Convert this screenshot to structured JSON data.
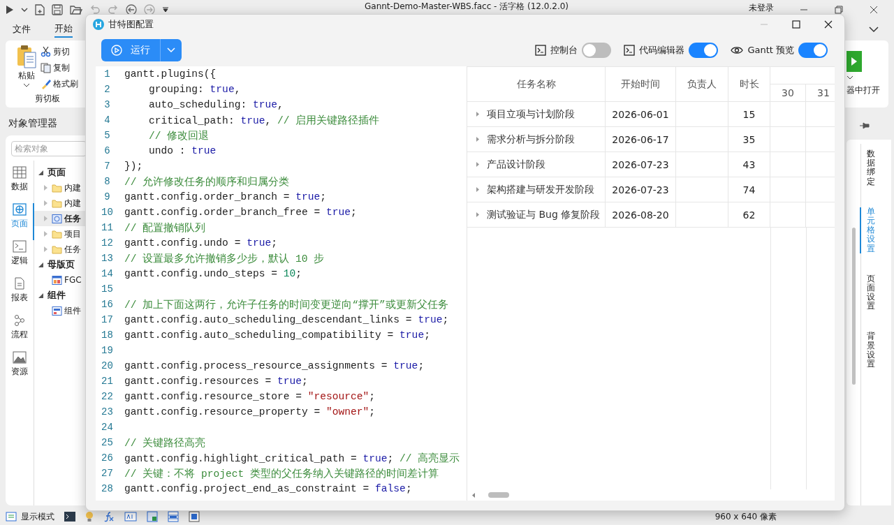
{
  "app": {
    "title": "Gannt-Demo-Master-WBS.facc - 活字格 (12.0.2.0)",
    "user": "未登录"
  },
  "menu": [
    {
      "label": "文件",
      "selected": false
    },
    {
      "label": "开始",
      "selected": true
    }
  ],
  "ribbon": {
    "paste": "粘贴",
    "cut": "剪切",
    "copy": "复制",
    "format_painter": "格式刷",
    "group": "剪切板",
    "open_in_browser": "器中打开"
  },
  "object_manager": {
    "title": "对象管理器",
    "search": {
      "placeholder": "检索对象"
    },
    "nav": [
      {
        "label": "数据",
        "kind": "data",
        "selected": false
      },
      {
        "label": "页面",
        "kind": "page",
        "selected": true
      },
      {
        "label": "逻辑",
        "kind": "logic",
        "selected": false
      },
      {
        "label": "报表",
        "kind": "report",
        "selected": false
      },
      {
        "label": "流程",
        "kind": "flow",
        "selected": false
      },
      {
        "label": "资源",
        "kind": "resource",
        "selected": false
      }
    ],
    "tree": [
      {
        "label": "页面",
        "expanded": true,
        "selected": false,
        "children": [
          {
            "label": "内建",
            "kind": "folder",
            "expanded": false,
            "selected": false
          },
          {
            "label": "内建",
            "kind": "folder",
            "expanded": false,
            "selected": false
          },
          {
            "label": "任务",
            "kind": "page",
            "expanded": false,
            "selected": true
          },
          {
            "label": "项目",
            "kind": "folder",
            "expanded": false,
            "selected": false
          },
          {
            "label": "任务",
            "kind": "folder",
            "expanded": false,
            "selected": false
          }
        ]
      },
      {
        "label": "母版页",
        "expanded": true,
        "selected": false,
        "children": [
          {
            "label": "FGC",
            "kind": "master",
            "selected": false
          }
        ]
      },
      {
        "label": "组件",
        "expanded": true,
        "selected": false,
        "children": [
          {
            "label": "组件",
            "kind": "component",
            "selected": false
          }
        ]
      }
    ]
  },
  "side_tabs": [
    {
      "label": "数据绑定",
      "selected": false
    },
    {
      "label": "单元格设置",
      "selected": true
    },
    {
      "label": "页面设置",
      "selected": false
    },
    {
      "label": "背景设置",
      "selected": false
    }
  ],
  "status_bar": {
    "mode": "显示模式",
    "size": "960 x 640 像素"
  },
  "dialog": {
    "title": "甘特图配置",
    "run_button": "运行",
    "toggles": [
      {
        "kind": "console",
        "label": "控制台",
        "on": false
      },
      {
        "kind": "code",
        "label": "代码编辑器",
        "on": true
      },
      {
        "kind": "preview",
        "label": "Gantt 预览",
        "on": true
      }
    ],
    "code": [
      {
        "number": "1",
        "tokens": [
          {
            "kind": "plain",
            "text": "gantt.plugins({"
          }
        ]
      },
      {
        "number": "2",
        "tokens": [
          {
            "kind": "plain",
            "text": "    grouping: "
          },
          {
            "kind": "keyword",
            "text": "true"
          },
          {
            "kind": "plain",
            "text": ","
          }
        ]
      },
      {
        "number": "3",
        "tokens": [
          {
            "kind": "plain",
            "text": "    auto_scheduling: "
          },
          {
            "kind": "keyword",
            "text": "true"
          },
          {
            "kind": "plain",
            "text": ","
          }
        ]
      },
      {
        "number": "4",
        "tokens": [
          {
            "kind": "plain",
            "text": "    critical_path: "
          },
          {
            "kind": "keyword",
            "text": "true"
          },
          {
            "kind": "plain",
            "text": ", "
          },
          {
            "kind": "comment",
            "text": "// 启用关键路径插件"
          }
        ]
      },
      {
        "number": "5",
        "tokens": [
          {
            "kind": "comment",
            "text": "    // 修改回退"
          }
        ]
      },
      {
        "number": "6",
        "tokens": [
          {
            "kind": "plain",
            "text": "    undo : "
          },
          {
            "kind": "keyword",
            "text": "true"
          }
        ]
      },
      {
        "number": "7",
        "tokens": [
          {
            "kind": "plain",
            "text": "});"
          }
        ]
      },
      {
        "number": "8",
        "tokens": [
          {
            "kind": "comment",
            "text": "// 允许修改任务的顺序和归属分类"
          }
        ]
      },
      {
        "number": "9",
        "tokens": [
          {
            "kind": "plain",
            "text": "gantt.config.order_branch = "
          },
          {
            "kind": "keyword",
            "text": "true"
          },
          {
            "kind": "plain",
            "text": ";"
          }
        ]
      },
      {
        "number": "10",
        "tokens": [
          {
            "kind": "plain",
            "text": "gantt.config.order_branch_free = "
          },
          {
            "kind": "keyword",
            "text": "true"
          },
          {
            "kind": "plain",
            "text": ";"
          }
        ]
      },
      {
        "number": "11",
        "tokens": [
          {
            "kind": "comment",
            "text": "// 配置撤销队列"
          }
        ]
      },
      {
        "number": "12",
        "tokens": [
          {
            "kind": "plain",
            "text": "gantt.config.undo = "
          },
          {
            "kind": "keyword",
            "text": "true"
          },
          {
            "kind": "plain",
            "text": ";"
          }
        ]
      },
      {
        "number": "13",
        "tokens": [
          {
            "kind": "comment",
            "text": "// 设置最多允许撤销多少步，默认 10 步"
          }
        ]
      },
      {
        "number": "14",
        "tokens": [
          {
            "kind": "plain",
            "text": "gantt.config.undo_steps = "
          },
          {
            "kind": "number",
            "text": "10"
          },
          {
            "kind": "plain",
            "text": ";"
          }
        ]
      },
      {
        "number": "15"
      },
      {
        "number": "16",
        "tokens": [
          {
            "kind": "comment",
            "text": "// 加上下面这两行，允许子任务的时间变更逆向“撑开”或更新父任务"
          }
        ]
      },
      {
        "number": "17",
        "tokens": [
          {
            "kind": "plain",
            "text": "gantt.config.auto_scheduling_descendant_links = "
          },
          {
            "kind": "keyword",
            "text": "true"
          },
          {
            "kind": "plain",
            "text": ";"
          }
        ]
      },
      {
        "number": "18",
        "tokens": [
          {
            "kind": "plain",
            "text": "gantt.config.auto_scheduling_compatibility = "
          },
          {
            "kind": "keyword",
            "text": "true"
          },
          {
            "kind": "plain",
            "text": ";"
          }
        ]
      },
      {
        "number": "19"
      },
      {
        "number": "20",
        "tokens": [
          {
            "kind": "plain",
            "text": "gantt.config.process_resource_assignments = "
          },
          {
            "kind": "keyword",
            "text": "true"
          },
          {
            "kind": "plain",
            "text": ";"
          }
        ]
      },
      {
        "number": "21",
        "tokens": [
          {
            "kind": "plain",
            "text": "gantt.config.resources = "
          },
          {
            "kind": "keyword",
            "text": "true"
          },
          {
            "kind": "plain",
            "text": ";"
          }
        ]
      },
      {
        "number": "22",
        "tokens": [
          {
            "kind": "plain",
            "text": "gantt.config.resource_store = "
          },
          {
            "kind": "string",
            "text": "\"resource\""
          },
          {
            "kind": "plain",
            "text": ";"
          }
        ]
      },
      {
        "number": "23",
        "tokens": [
          {
            "kind": "plain",
            "text": "gantt.config.resource_property = "
          },
          {
            "kind": "string",
            "text": "\"owner\""
          },
          {
            "kind": "plain",
            "text": ";"
          }
        ]
      },
      {
        "number": "24"
      },
      {
        "number": "25",
        "tokens": [
          {
            "kind": "comment",
            "text": "// 关键路径高亮"
          }
        ]
      },
      {
        "number": "26",
        "tokens": [
          {
            "kind": "plain",
            "text": "gantt.config.highlight_critical_path = "
          },
          {
            "kind": "keyword",
            "text": "true"
          },
          {
            "kind": "plain",
            "text": "; "
          },
          {
            "kind": "comment",
            "text": "// 高亮显示"
          }
        ]
      },
      {
        "number": "27",
        "tokens": [
          {
            "kind": "comment",
            "text": "// 关键：不将 project 类型的父任务纳入关键路径的时间差计算"
          }
        ]
      },
      {
        "number": "28",
        "tokens": [
          {
            "kind": "plain",
            "text": "gantt.config.project_end_as_constraint = "
          },
          {
            "kind": "keyword",
            "text": "false"
          },
          {
            "kind": "plain",
            "text": ";"
          }
        ]
      }
    ],
    "gantt": {
      "columns": [
        "任务名称",
        "开始时间",
        "负责人",
        "时长"
      ],
      "scale": [
        "30",
        "31"
      ],
      "rows": [
        {
          "name": "项目立项与计划阶段",
          "start": "2026-06-01",
          "duration": "15",
          "expanded": false
        },
        {
          "name": "需求分析与拆分阶段",
          "start": "2026-06-17",
          "duration": "35",
          "expanded": false
        },
        {
          "name": "产品设计阶段",
          "start": "2026-07-23",
          "duration": "43",
          "expanded": false
        },
        {
          "name": "架构搭建与研发开发阶段",
          "start": "2026-07-23",
          "duration": "74",
          "expanded": false
        },
        {
          "name": "测试验证与 Bug 修复阶段",
          "start": "2026-08-20",
          "duration": "62",
          "expanded": false
        }
      ]
    }
  }
}
